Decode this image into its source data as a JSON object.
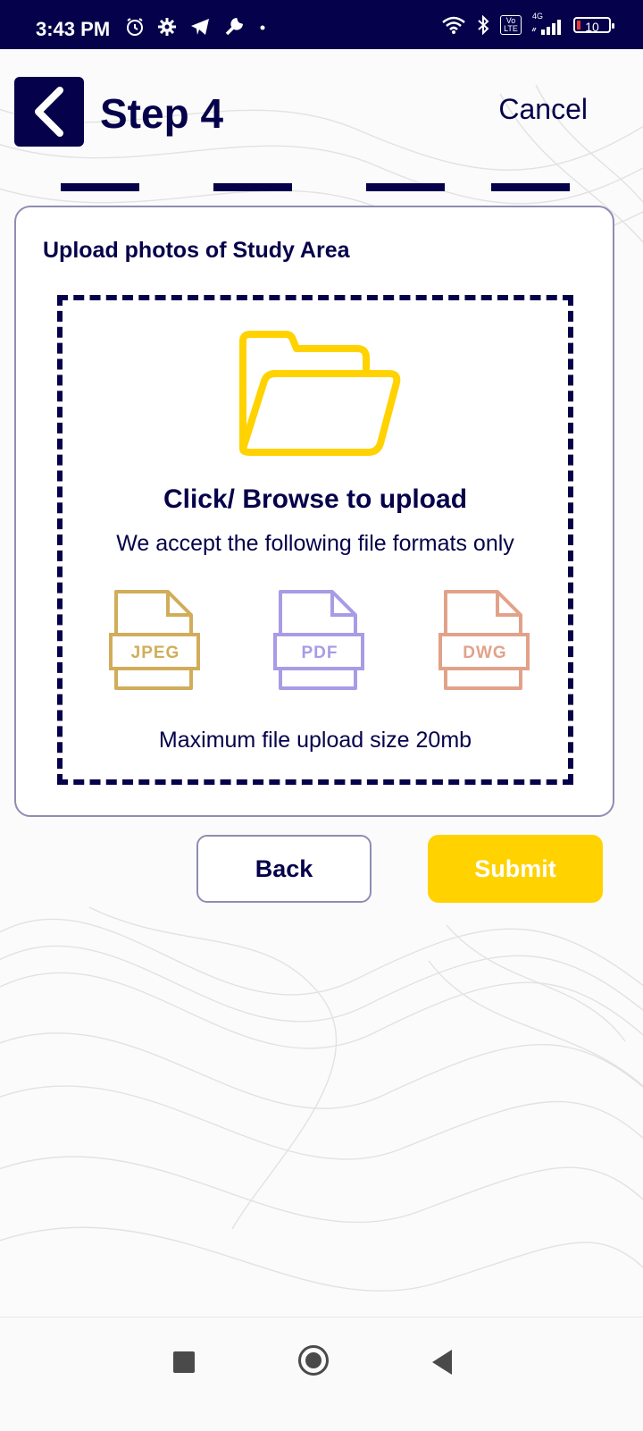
{
  "status_bar": {
    "time": "3:43 PM",
    "network": "4G",
    "volte": "Vo LTE",
    "battery": "10",
    "icons_left": [
      "alarm-icon",
      "gear-icon",
      "telegram-icon",
      "wrench-icon",
      "dot-icon"
    ],
    "icons_right": [
      "wifi-icon",
      "bluetooth-icon",
      "volte-icon",
      "signal-icon",
      "battery-icon"
    ]
  },
  "header": {
    "title": "Step 4",
    "cancel_label": "Cancel",
    "back_icon": "chevron-left-icon"
  },
  "progress": {
    "total_steps": 4,
    "current_step": 4
  },
  "upload_card": {
    "title": "Upload photos of Study Area",
    "dropzone_title": "Click/ Browse to upload",
    "dropzone_subtitle": "We accept the following file formats only",
    "formats": [
      {
        "label": "JPEG",
        "color": "#d1ad5a"
      },
      {
        "label": "PDF",
        "color": "#a99be6"
      },
      {
        "label": "DWG",
        "color": "#e2a28a"
      }
    ],
    "max_size_text": "Maximum file upload size 20mb",
    "folder_color": "#ffd200"
  },
  "actions": {
    "back_label": "Back",
    "submit_label": "Submit",
    "submit_color": "#ffd200"
  },
  "nav_bar": {
    "icons": [
      "recents-square-icon",
      "home-circle-icon",
      "back-triangle-icon"
    ]
  },
  "colors": {
    "primary": "#05014a",
    "accent": "#ffd200"
  }
}
